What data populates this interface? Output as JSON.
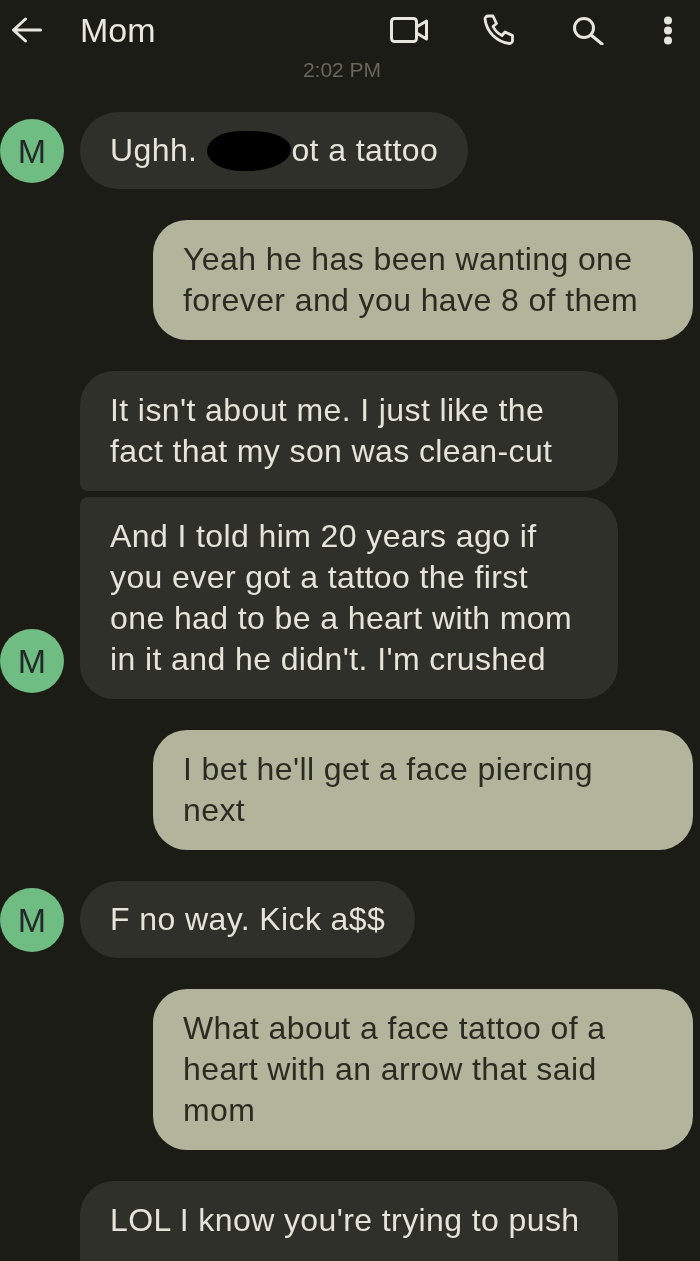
{
  "header": {
    "title": "Mom",
    "timestamp": "2:02 PM"
  },
  "messages": [
    {
      "outgoing": false,
      "avatar": "M",
      "segments": [
        {
          "kind": "text",
          "text": "Ughh."
        },
        {
          "kind": "redaction"
        },
        {
          "kind": "text",
          "text": "ot a tattoo"
        }
      ]
    },
    {
      "outgoing": true,
      "text": "Yeah he has been wanting one\nforever and you have 8 of them"
    },
    {
      "outgoing": false,
      "text": "It isn't about me. I just like the\nfact that my son was clean-cut"
    },
    {
      "outgoing": false,
      "avatar": "M",
      "text": "And I told him 20 years ago if\nyou ever got a tattoo the first\none had to be a heart with mom\nin it and he didn't. I'm crushed"
    },
    {
      "outgoing": true,
      "text": "I bet he'll get a face piercing\nnext"
    },
    {
      "outgoing": false,
      "avatar": "M",
      "text": "F no way. Kick a$$"
    },
    {
      "outgoing": true,
      "text": "What about a face tattoo of a\nheart with an arrow that said\nmom"
    },
    {
      "outgoing": false,
      "text": "LOL I know you're trying to push",
      "cut_off": true
    }
  ]
}
